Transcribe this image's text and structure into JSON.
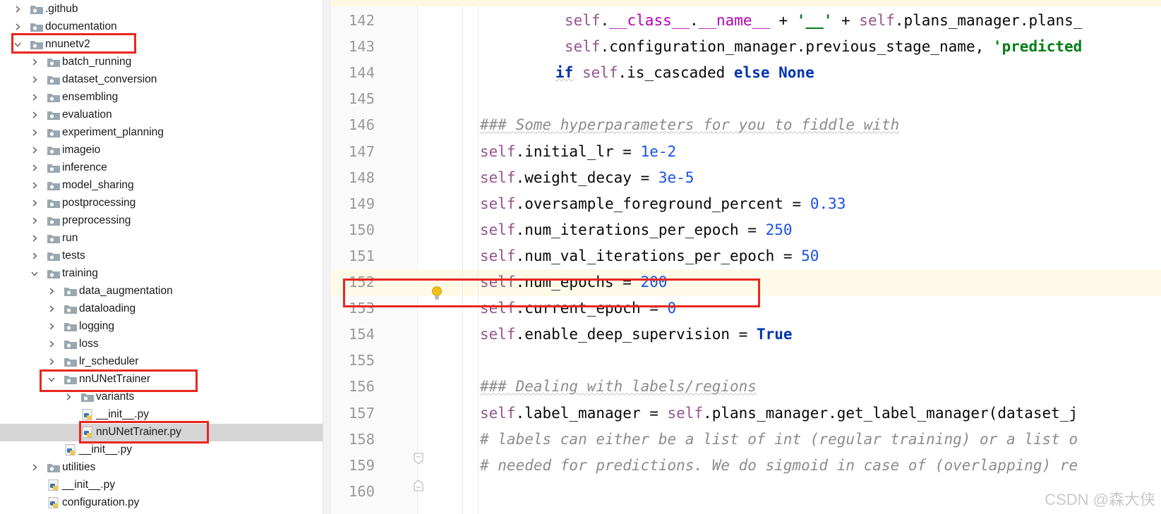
{
  "project_tree": {
    "items": [
      {
        "label": ".github",
        "type": "folder",
        "depth": 0,
        "expanded": false,
        "has_arrow": true
      },
      {
        "label": "documentation",
        "type": "folder",
        "depth": 0,
        "expanded": false,
        "has_arrow": true
      },
      {
        "label": "nnunetv2",
        "type": "folder",
        "depth": 0,
        "expanded": true,
        "has_arrow": true,
        "highlighted": true
      },
      {
        "label": "batch_running",
        "type": "folder",
        "depth": 1,
        "expanded": false,
        "has_arrow": true
      },
      {
        "label": "dataset_conversion",
        "type": "folder",
        "depth": 1,
        "expanded": false,
        "has_arrow": true
      },
      {
        "label": "ensembling",
        "type": "folder",
        "depth": 1,
        "expanded": false,
        "has_arrow": true
      },
      {
        "label": "evaluation",
        "type": "folder",
        "depth": 1,
        "expanded": false,
        "has_arrow": true
      },
      {
        "label": "experiment_planning",
        "type": "folder",
        "depth": 1,
        "expanded": false,
        "has_arrow": true
      },
      {
        "label": "imageio",
        "type": "folder",
        "depth": 1,
        "expanded": false,
        "has_arrow": true
      },
      {
        "label": "inference",
        "type": "folder",
        "depth": 1,
        "expanded": false,
        "has_arrow": true
      },
      {
        "label": "model_sharing",
        "type": "folder",
        "depth": 1,
        "expanded": false,
        "has_arrow": true
      },
      {
        "label": "postprocessing",
        "type": "folder",
        "depth": 1,
        "expanded": false,
        "has_arrow": true
      },
      {
        "label": "preprocessing",
        "type": "folder",
        "depth": 1,
        "expanded": false,
        "has_arrow": true
      },
      {
        "label": "run",
        "type": "folder",
        "depth": 1,
        "expanded": false,
        "has_arrow": true
      },
      {
        "label": "tests",
        "type": "folder",
        "depth": 1,
        "expanded": false,
        "has_arrow": true
      },
      {
        "label": "training",
        "type": "folder",
        "depth": 1,
        "expanded": true,
        "has_arrow": true
      },
      {
        "label": "data_augmentation",
        "type": "folder",
        "depth": 2,
        "expanded": false,
        "has_arrow": true
      },
      {
        "label": "dataloading",
        "type": "folder",
        "depth": 2,
        "expanded": false,
        "has_arrow": true
      },
      {
        "label": "logging",
        "type": "folder",
        "depth": 2,
        "expanded": false,
        "has_arrow": true
      },
      {
        "label": "loss",
        "type": "folder",
        "depth": 2,
        "expanded": false,
        "has_arrow": true
      },
      {
        "label": "lr_scheduler",
        "type": "folder",
        "depth": 2,
        "expanded": false,
        "has_arrow": true
      },
      {
        "label": "nnUNetTrainer",
        "type": "folder",
        "depth": 2,
        "expanded": true,
        "has_arrow": true,
        "highlighted": true
      },
      {
        "label": "variants",
        "type": "folder",
        "depth": 3,
        "expanded": false,
        "has_arrow": true
      },
      {
        "label": "__init__.py",
        "type": "python",
        "depth": 3,
        "has_arrow": false
      },
      {
        "label": "nnUNetTrainer.py",
        "type": "python",
        "depth": 3,
        "has_arrow": false,
        "selected": true,
        "highlighted": true
      },
      {
        "label": "__init__.py",
        "type": "python",
        "depth": 2,
        "has_arrow": false
      },
      {
        "label": "utilities",
        "type": "folder",
        "depth": 1,
        "expanded": false,
        "has_arrow": true
      },
      {
        "label": "__init__.py",
        "type": "python",
        "depth": 1,
        "has_arrow": false
      },
      {
        "label": "configuration.py",
        "type": "python",
        "depth": 1,
        "has_arrow": false
      }
    ]
  },
  "editor": {
    "current_line": 152,
    "highlighted_line": 152,
    "lines": [
      {
        "num": "142",
        "indent": 5,
        "tokens": [
          [
            "self",
            "self"
          ],
          [
            "",
            "."
          ],
          [
            "dunder",
            "__class__"
          ],
          [
            "",
            "."
          ],
          [
            "dunder",
            "__name__"
          ],
          [
            "",
            " + "
          ],
          [
            "str",
            "'__'"
          ],
          [
            "",
            " + "
          ],
          [
            "self",
            "self"
          ],
          [
            "",
            ".plans_manager.plans_"
          ]
        ]
      },
      {
        "num": "143",
        "indent": 5,
        "tokens": [
          [
            "self",
            "self"
          ],
          [
            "",
            ".configuration_manager.previous_stage_name, "
          ],
          [
            "str",
            "'predicted"
          ]
        ]
      },
      {
        "num": "144",
        "indent": 4,
        "tokens": [
          [
            "kw wavy",
            "if"
          ],
          [
            "",
            " "
          ],
          [
            "self",
            "self"
          ],
          [
            "",
            ".is_cascaded "
          ],
          [
            "kw",
            "else"
          ],
          [
            "",
            " "
          ],
          [
            "kw",
            "None"
          ]
        ]
      },
      {
        "num": "145",
        "indent": 0,
        "tokens": []
      },
      {
        "num": "146",
        "indent": 0,
        "tokens": [
          [
            "cmt wavy",
            "### Some hyperparameters for you to fiddle with"
          ]
        ]
      },
      {
        "num": "147",
        "indent": 0,
        "tokens": [
          [
            "self",
            "self"
          ],
          [
            "",
            ".initial_lr = "
          ],
          [
            "num",
            "1e-2"
          ]
        ]
      },
      {
        "num": "148",
        "indent": 0,
        "tokens": [
          [
            "self",
            "self"
          ],
          [
            "",
            ".weight_decay = "
          ],
          [
            "num",
            "3e-5"
          ]
        ]
      },
      {
        "num": "149",
        "indent": 0,
        "tokens": [
          [
            "self",
            "self"
          ],
          [
            "",
            ".oversample_foreground_percent = "
          ],
          [
            "num",
            "0.33"
          ]
        ]
      },
      {
        "num": "150",
        "indent": 0,
        "tokens": [
          [
            "self",
            "self"
          ],
          [
            "",
            ".num_iterations_per_epoch = "
          ],
          [
            "num",
            "250"
          ]
        ]
      },
      {
        "num": "151",
        "indent": 0,
        "tokens": [
          [
            "self",
            "self"
          ],
          [
            "",
            ".num_val_iterations_per_epoch = "
          ],
          [
            "num",
            "50"
          ]
        ]
      },
      {
        "num": "152",
        "indent": 0,
        "tokens": [
          [
            "self",
            "self"
          ],
          [
            "",
            ".num_epochs = "
          ],
          [
            "num",
            "200"
          ]
        ]
      },
      {
        "num": "153",
        "indent": 0,
        "tokens": [
          [
            "self",
            "self"
          ],
          [
            "",
            ".current_epoch = "
          ],
          [
            "num",
            "0"
          ]
        ]
      },
      {
        "num": "154",
        "indent": 0,
        "tokens": [
          [
            "self",
            "self"
          ],
          [
            "",
            ".enable_deep_supervision = "
          ],
          [
            "kw",
            "True"
          ]
        ]
      },
      {
        "num": "155",
        "indent": 0,
        "tokens": []
      },
      {
        "num": "156",
        "indent": 0,
        "tokens": [
          [
            "cmt wavy",
            "### Dealing with labels/regions"
          ]
        ]
      },
      {
        "num": "157",
        "indent": 0,
        "tokens": [
          [
            "self",
            "self"
          ],
          [
            "",
            ".label_manager = "
          ],
          [
            "self",
            "self"
          ],
          [
            "",
            ".plans_manager.get_label_manager(dataset_j"
          ]
        ]
      },
      {
        "num": "158",
        "indent": 0,
        "tokens": [
          [
            "cmt",
            "# labels can either be a list of int (regular training) or a list o"
          ]
        ]
      },
      {
        "num": "159",
        "indent": 0,
        "tokens": [
          [
            "cmt",
            "# needed for predictions. We do sigmoid in case of (overlapping) re"
          ]
        ]
      },
      {
        "num": "160",
        "indent": 0,
        "tokens": []
      }
    ]
  },
  "icons": {
    "chevron_right": "chevron-right-icon",
    "chevron_down": "chevron-down-icon",
    "folder": "folder-icon",
    "python_file": "python-file-icon",
    "intention_bulb": "lightbulb-icon",
    "fold_marker": "fold-marker-icon"
  },
  "colors": {
    "highlight_box": "#e8261f",
    "selected_row": "#d5d5d5",
    "keyword": "#0033b3",
    "self": "#94558d",
    "number": "#1750eb",
    "string": "#067d17",
    "comment": "#8c8c8c",
    "current_line_bg": "#fdfbe8"
  },
  "watermark": "CSDN @森大侠"
}
